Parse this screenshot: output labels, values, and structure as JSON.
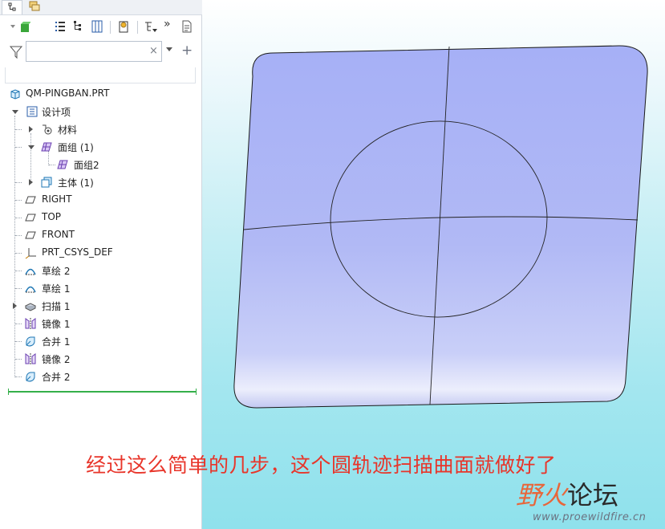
{
  "model_tree": {
    "filter_placeholder": "",
    "clear_glyph": "×",
    "add_glyph": "+",
    "items": [
      {
        "label": "QM-PINGBAN.PRT",
        "icon": "part-icon"
      },
      {
        "label": "设计项",
        "icon": "design-items-icon"
      },
      {
        "label": "材料",
        "icon": "material-icon"
      },
      {
        "label": "面组 (1)",
        "icon": "quilt-group-icon"
      },
      {
        "label": "面组2",
        "icon": "quilt-icon"
      },
      {
        "label": "主体 (1)",
        "icon": "body-icon"
      },
      {
        "label": "RIGHT",
        "icon": "datum-plane-icon"
      },
      {
        "label": "TOP",
        "icon": "datum-plane-icon"
      },
      {
        "label": "FRONT",
        "icon": "datum-plane-icon"
      },
      {
        "label": "PRT_CSYS_DEF",
        "icon": "csys-icon"
      },
      {
        "label": "草绘 2",
        "icon": "sketch-icon"
      },
      {
        "label": "草绘 1",
        "icon": "sketch-icon"
      },
      {
        "label": "扫描 1",
        "icon": "sweep-icon"
      },
      {
        "label": "镜像 1",
        "icon": "mirror-icon"
      },
      {
        "label": "合并 1",
        "icon": "merge-icon"
      },
      {
        "label": "镜像 2",
        "icon": "mirror-icon"
      },
      {
        "label": "合并 2",
        "icon": "merge-icon"
      }
    ]
  },
  "toolbar": {
    "more_glyph": "»"
  },
  "caption": "经过这么简单的几步，这个圆轨迹扫描曲面就做好了",
  "watermark": {
    "red_part": "野火",
    "black_part": "论坛",
    "url": "www.proewildfire.cn"
  },
  "colors": {
    "surface": "#a9b3f6",
    "caption": "#e8352a",
    "insert_bar": "#35b04a"
  }
}
